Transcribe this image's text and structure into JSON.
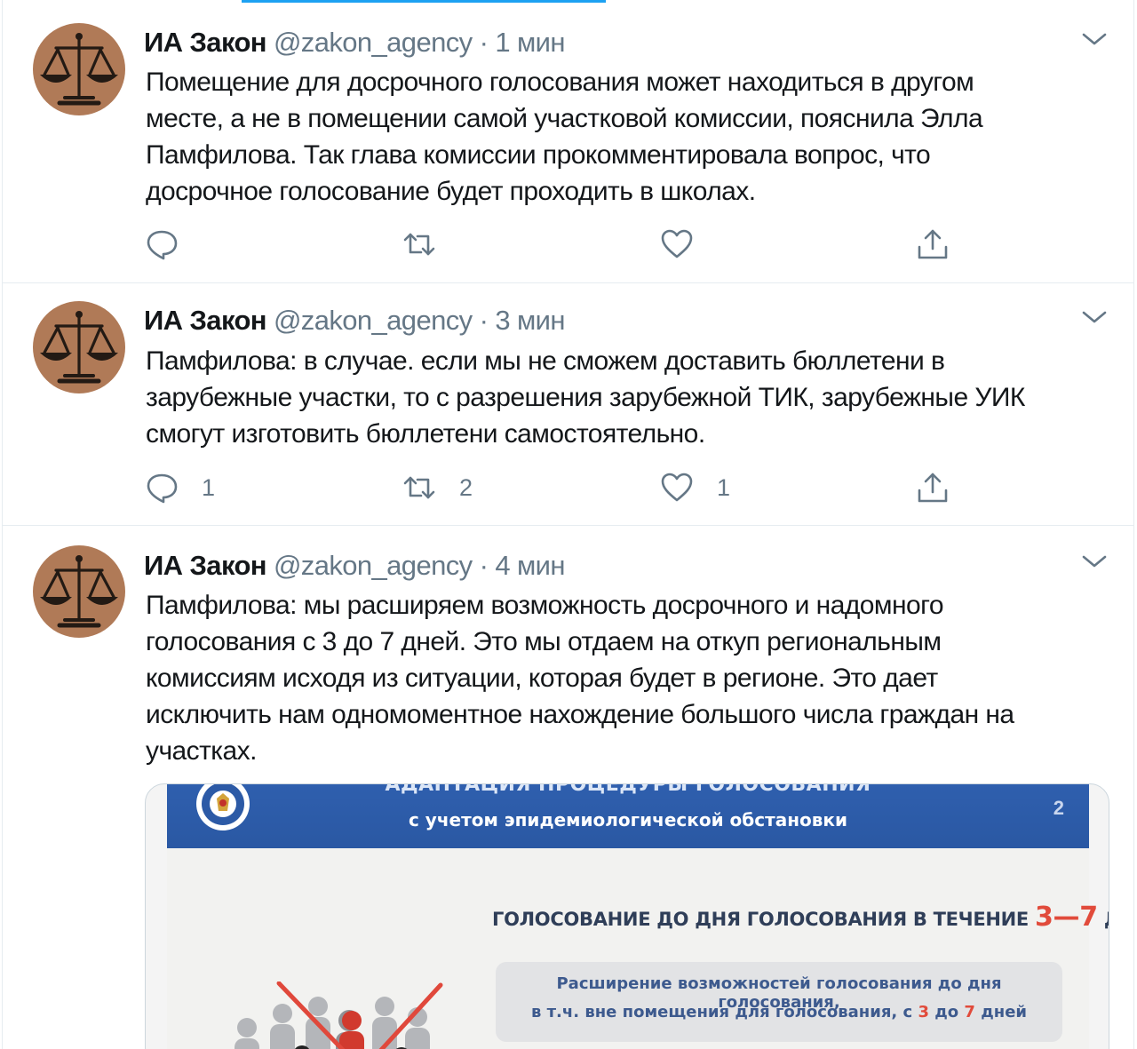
{
  "colors": {
    "accent": "#1da1f2",
    "text": "#14171a",
    "muted": "#657786",
    "avatar_bg": "#b07a57",
    "slide_blue": "#2f5fae",
    "slide_red": "#e14b3b"
  },
  "icons": {
    "reply": "reply-icon",
    "retweet": "retweet-icon",
    "like": "heart-icon",
    "share": "share-icon",
    "caret": "chevron-down-icon",
    "avatar": "scales-of-justice-icon"
  },
  "tweets": [
    {
      "author": "ИА Закон",
      "handle": "@zakon_agency",
      "separator": "·",
      "time": "1 мин",
      "lines": [
        "Помещение для досрочного голосования может находиться в другом",
        "месте, а не в помещении самой участковой комиссии, пояснила Элла",
        "Памфилова. Так глава комиссии прокомментировала вопрос, что",
        "досрочное голосование будет проходить в школах."
      ],
      "replies": "",
      "retweets": "",
      "likes": ""
    },
    {
      "author": "ИА Закон",
      "handle": "@zakon_agency",
      "separator": "·",
      "time": "3 мин",
      "lines": [
        "Памфилова: в случае. если мы не сможем доставить бюллетени в",
        "зарубежные участки, то с разрешения зарубежной ТИК, зарубежные УИК",
        "смогут изготовить бюллетени самостоятельно."
      ],
      "replies": "1",
      "retweets": "2",
      "likes": "1"
    },
    {
      "author": "ИА Закон",
      "handle": "@zakon_agency",
      "separator": "·",
      "time": "4 мин",
      "lines": [
        "Памфилова: мы расширяем возможность досрочного и надомного",
        "голосования с 3 до 7 дней. Это мы отдаем на откуп региональным",
        "комиссиям исходя из ситуации, которая будет в регионе. Это дает",
        "исключить нам одномоментное нахождение большого числа граждан на",
        "участках."
      ],
      "media": {
        "header_line1": "АДАПТАЦИЯ ПРОЦЕДУРЫ ГОЛОСОВАНИЯ",
        "header_line2": "с учетом эпидемиологической обстановки",
        "slide_number": "2",
        "title_prefix": "ГОЛОСОВАНИЕ ДО ДНЯ ГОЛОСОВАНИЯ В ТЕЧЕНИЕ ",
        "title_days": "3—7",
        "title_suffix": " ДНЕЙ",
        "box_line1": "Расширение возможностей голосования до дня голосования,",
        "box_line2_prefix": "в т.ч. вне помещения для голосования, с ",
        "box_from": "3",
        "box_mid": " до ",
        "box_to": "7",
        "box_suffix": " дней"
      }
    }
  ]
}
